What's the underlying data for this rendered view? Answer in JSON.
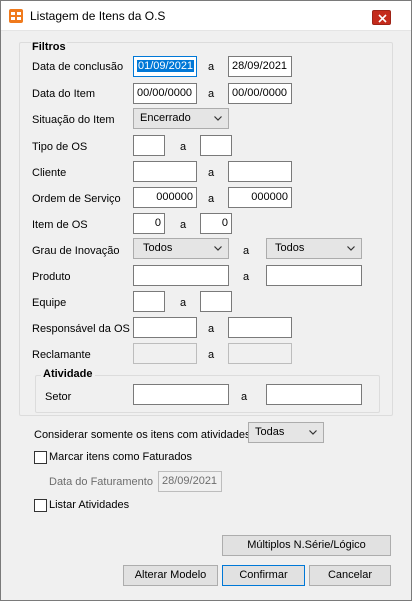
{
  "window": {
    "title": "Listagem de Itens da O.S"
  },
  "filtros": {
    "title": "Filtros",
    "a_label": "a",
    "data_conclusao": {
      "label": "Data de conclusão",
      "from": "01/09/2021",
      "to": "28/09/2021"
    },
    "data_item": {
      "label": "Data do Item",
      "from": "00/00/0000",
      "to": "00/00/0000"
    },
    "situacao_item": {
      "label": "Situação do Item",
      "value": "Encerrado"
    },
    "tipo_os": {
      "label": "Tipo de OS",
      "from": "",
      "to": ""
    },
    "cliente": {
      "label": "Cliente",
      "from": "",
      "to": ""
    },
    "ordem_servico": {
      "label": "Ordem de Serviço",
      "from": "000000",
      "to": "000000"
    },
    "item_os": {
      "label": "Item de OS",
      "from": "0",
      "to": "0"
    },
    "grau_inovacao": {
      "label": "Grau de Inovação",
      "from": "Todos",
      "to": "Todos"
    },
    "produto": {
      "label": "Produto",
      "from": "",
      "to": ""
    },
    "equipe": {
      "label": "Equipe",
      "from": "",
      "to": ""
    },
    "responsavel": {
      "label": "Responsável da OS",
      "from": "",
      "to": ""
    },
    "reclamante": {
      "label": "Reclamante",
      "from": "",
      "to": ""
    }
  },
  "atividade": {
    "title": "Atividade",
    "setor": {
      "label": "Setor",
      "from": "",
      "to": ""
    }
  },
  "options": {
    "considerar_label": "Considerar somente os itens com atividades",
    "considerar_value": "Todas",
    "marcar_faturados_label": "Marcar itens como Faturados",
    "marcar_faturados_checked": false,
    "data_faturamento_label": "Data do Faturamento",
    "data_faturamento_value": "28/09/2021",
    "listar_atividades_label": "Listar Atividades",
    "listar_atividades_checked": false
  },
  "buttons": {
    "multiplos": "Múltiplos N.Série/Lógico",
    "alterar_modelo": "Alterar Modelo",
    "confirmar": "Confirmar",
    "cancelar": "Cancelar"
  },
  "colors": {
    "selection": "#0078d7",
    "close_button": "#c42b1c",
    "app_icon": "#f07a1c"
  },
  "icons": [
    "app-icon",
    "close-icon",
    "chevron-down-icon"
  ]
}
